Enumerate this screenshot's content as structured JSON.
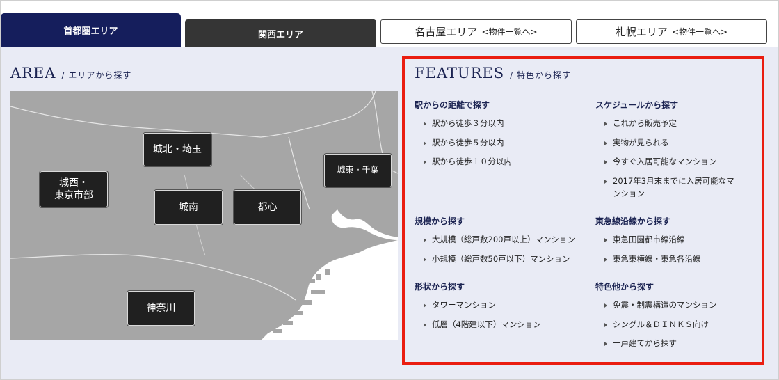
{
  "tabs": {
    "shutoken": "首都圏エリア",
    "kansai": "関西エリア",
    "nagoya": "名古屋エリア",
    "nagoya_sub": "<物件一覧へ>",
    "sapporo": "札幌エリア",
    "sapporo_sub": "<物件一覧へ>"
  },
  "area": {
    "title": "AREA",
    "subtitle": "/ エリアから探す",
    "regions": {
      "johoku": "城北・埼玉",
      "josai_line1": "城西・",
      "josai_line2": "東京市部",
      "joto": "城東・千葉",
      "jonan": "城南",
      "toshin": "都心",
      "kanagawa": "神奈川"
    }
  },
  "features": {
    "title": "FEATURES",
    "subtitle": "/ 特色から探す",
    "groups": {
      "distance": {
        "title": "駅からの距離で探す",
        "items": [
          "駅から徒歩３分以内",
          "駅から徒歩５分以内",
          "駅から徒歩１０分以内"
        ]
      },
      "schedule": {
        "title": "スケジュールから探す",
        "items": [
          "これから販売予定",
          "実物が見られる",
          "今すぐ入居可能なマンション",
          "2017年3月末までに入居可能なマンション"
        ]
      },
      "scale": {
        "title": "規模から探す",
        "items": [
          "大規模（総戸数200戸以上）マンション",
          "小規模（総戸数50戸以下）マンション"
        ]
      },
      "tokyu": {
        "title": "東急線沿線から探す",
        "items": [
          "東急田園都市線沿線",
          "東急東横線・東急各沿線"
        ]
      },
      "shape": {
        "title": "形状から探す",
        "items": [
          "タワーマンション",
          "低層（4階建以下）マンション"
        ]
      },
      "other": {
        "title": "特色他から探す",
        "items": [
          "免震・制震構造のマンション",
          "シングル＆ＤＩＮＫＳ向け",
          "一戸建てから探す"
        ]
      }
    }
  },
  "colors": {
    "navy": "#151e5c",
    "dark_tab": "#353535",
    "highlight_border": "#ea1d10",
    "panel_bg": "#e9ebf5",
    "map_land": "#a3a3a3"
  }
}
